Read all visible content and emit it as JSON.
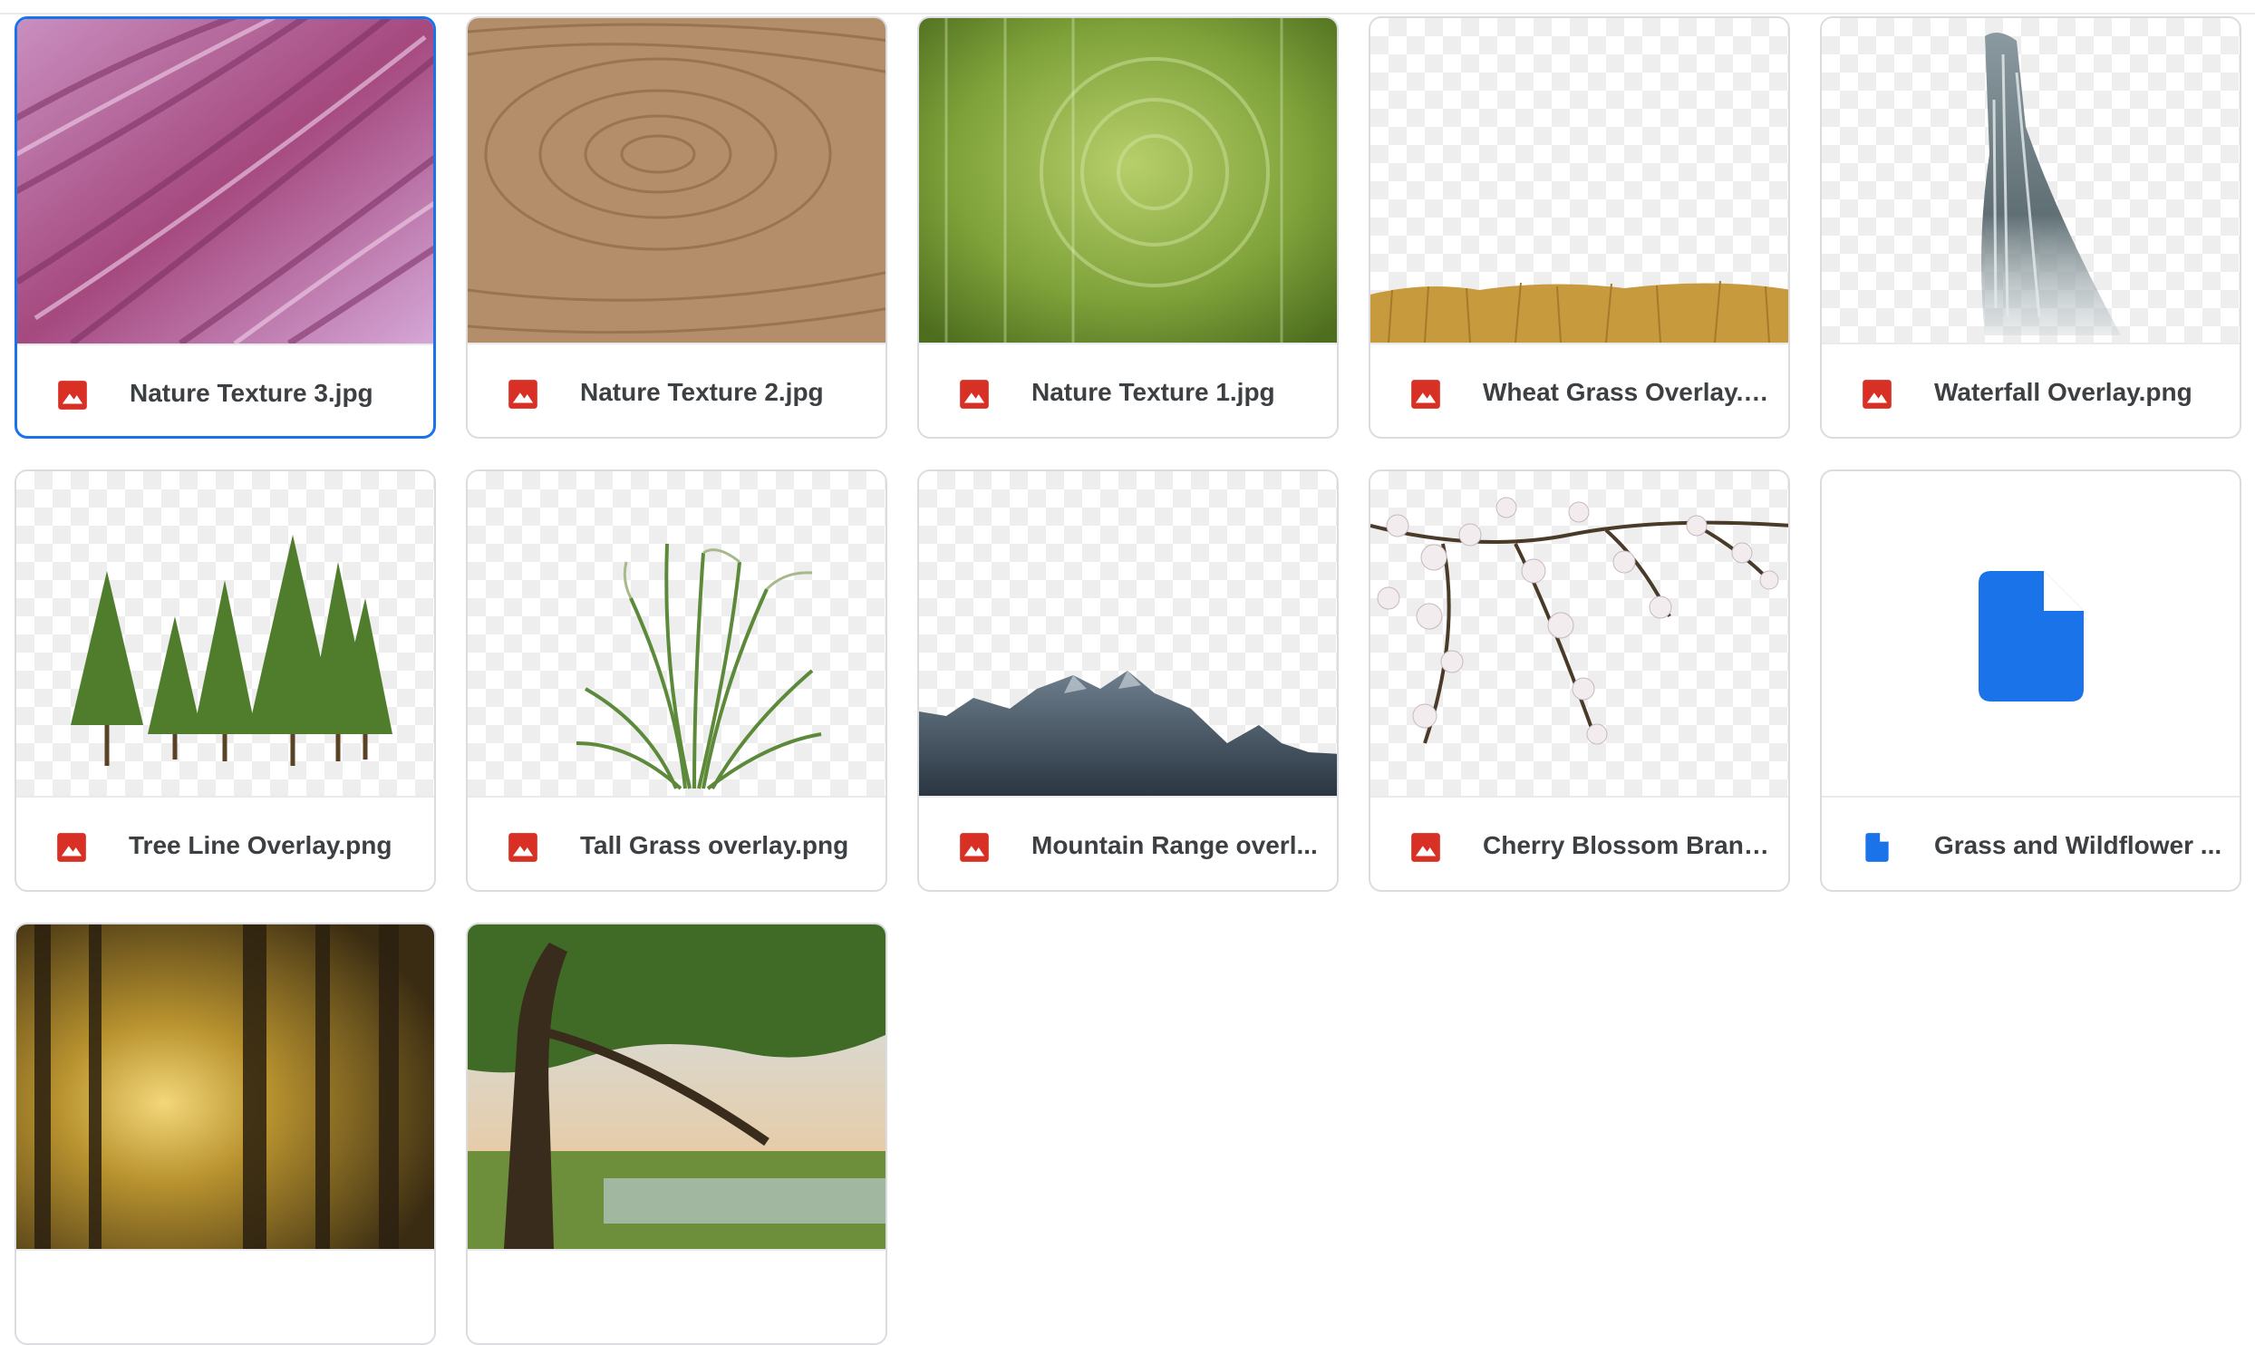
{
  "colors": {
    "image_icon": "#d93025",
    "doc_icon": "#1a73e8",
    "selected_border": "#1a73e8",
    "card_border": "#dadce0"
  },
  "files": [
    {
      "name": "Nature Texture 3.jpg",
      "icon": "image-icon",
      "selected": true
    },
    {
      "name": "Nature Texture 2.jpg",
      "icon": "image-icon"
    },
    {
      "name": "Nature Texture 1.jpg",
      "icon": "image-icon"
    },
    {
      "name": "Wheat Grass Overlay.p...",
      "icon": "image-icon"
    },
    {
      "name": "Waterfall Overlay.png",
      "icon": "image-icon"
    },
    {
      "name": "Tree Line Overlay.png",
      "icon": "image-icon"
    },
    {
      "name": "Tall Grass overlay.png",
      "icon": "image-icon"
    },
    {
      "name": "Mountain Range overl...",
      "icon": "image-icon"
    },
    {
      "name": "Cherry Blossom Branc...",
      "icon": "image-icon"
    },
    {
      "name": "Grass and Wildflower ...",
      "icon": "document-icon"
    },
    {
      "name": "",
      "icon": ""
    },
    {
      "name": "",
      "icon": ""
    }
  ]
}
